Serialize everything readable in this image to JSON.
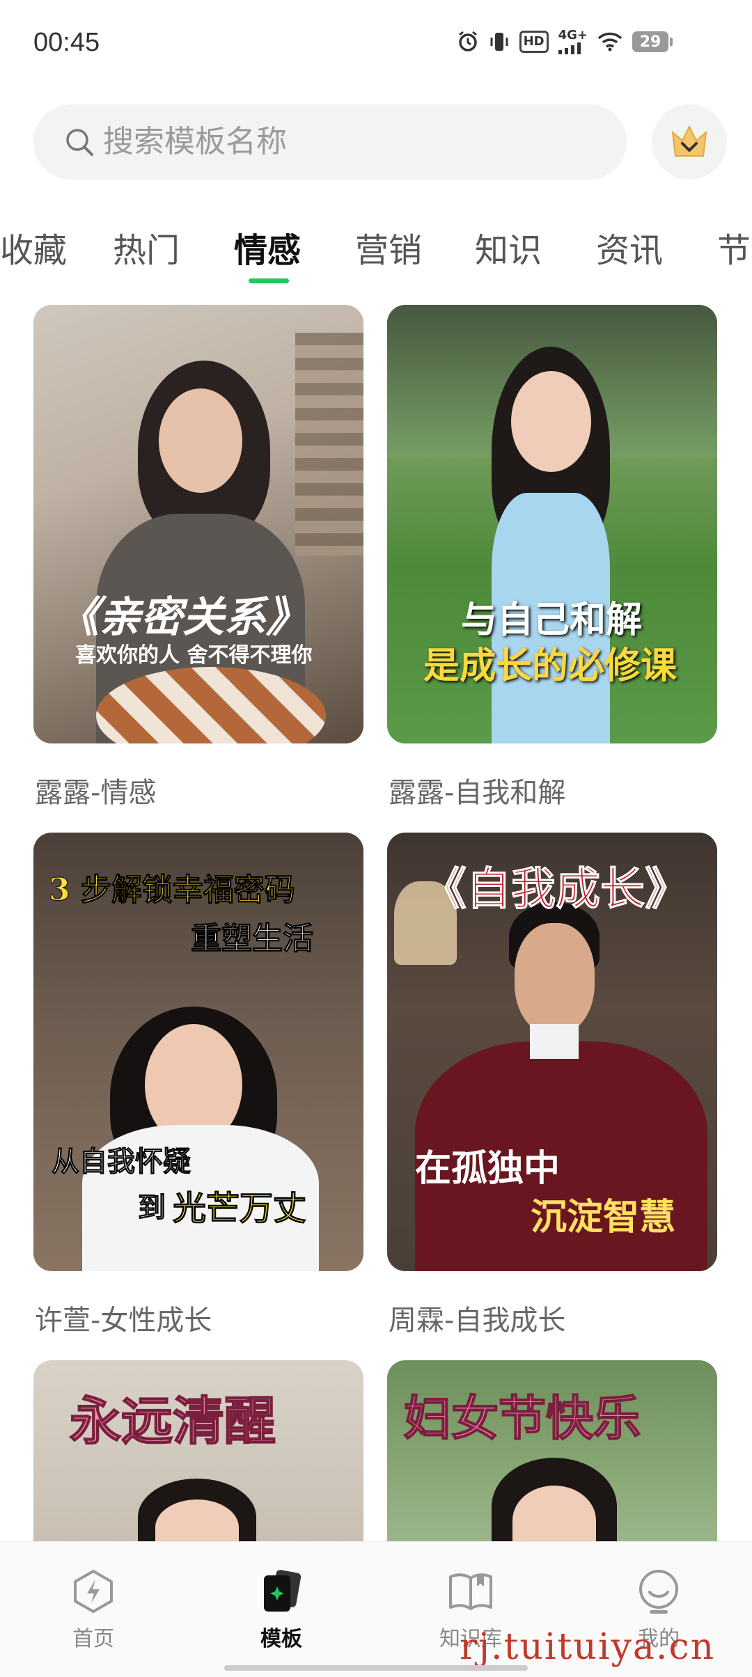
{
  "status_bar": {
    "time": "00:45",
    "network": "4G+",
    "hd": "HD",
    "battery": "29"
  },
  "search": {
    "placeholder": "搜索模板名称"
  },
  "tabs": [
    {
      "label": "收藏"
    },
    {
      "label": "热门"
    },
    {
      "label": "情感",
      "active": true
    },
    {
      "label": "营销"
    },
    {
      "label": "知识"
    },
    {
      "label": "资讯"
    },
    {
      "label": "节"
    }
  ],
  "cards": [
    {
      "label": "露露-情感",
      "overlay_lines": [
        "《亲密关系》",
        "喜欢你的人 舍不得不理你"
      ]
    },
    {
      "label": "露露-自我和解",
      "overlay_lines": [
        "与自己和解",
        "是成长的必修课"
      ]
    },
    {
      "label": "许萱-女性成长",
      "overlay_lines": [
        "3 步解锁幸福密码",
        "重塑生活",
        "从自我怀疑",
        "到",
        "光芒万丈"
      ]
    },
    {
      "label": "周霖-自我成长",
      "overlay_lines": [
        "《自我成长》",
        "在孤独中",
        "沉淀智慧"
      ]
    },
    {
      "label": "",
      "overlay_lines": [
        "永远清醒"
      ]
    },
    {
      "label": "",
      "overlay_lines": [
        "妇女节快乐"
      ]
    }
  ],
  "bottom_nav": [
    {
      "label": "首页",
      "icon": "lightning-icon"
    },
    {
      "label": "模板",
      "icon": "template-cards-icon",
      "active": true
    },
    {
      "label": "知识库",
      "icon": "book-icon"
    },
    {
      "label": "我的",
      "icon": "profile-icon"
    }
  ],
  "watermark": "rj.tuituiya.cn",
  "colors": {
    "accent": "#22c55e",
    "tab_text": "#555555",
    "label_text": "#666666"
  }
}
